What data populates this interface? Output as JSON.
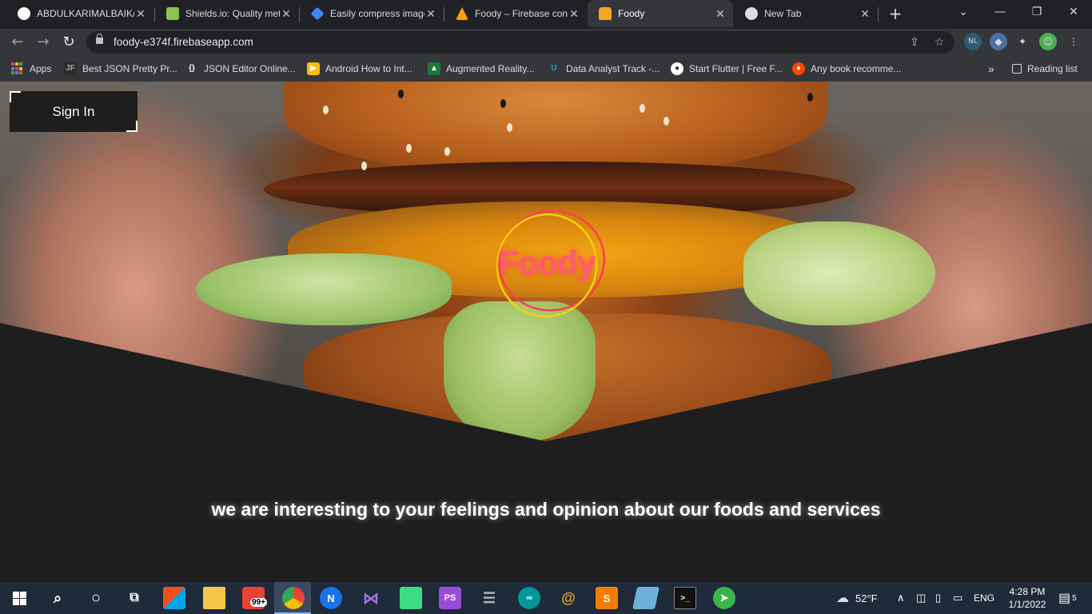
{
  "browser": {
    "tabs": [
      {
        "title": "ABDULKARIMALBAIK/",
        "favicon_color": "#ffffff",
        "active": false
      },
      {
        "title": "Shields.io: Quality met",
        "favicon_color": "#8bc34a",
        "active": false
      },
      {
        "title": "Easily compress image",
        "favicon_color": "#4285f4",
        "active": false
      },
      {
        "title": "Foody – Firebase cons",
        "favicon_color": "#ffa000",
        "active": false
      },
      {
        "title": "Foody",
        "favicon_color": "#f5a623",
        "active": true
      },
      {
        "title": "New Tab",
        "favicon_color": "#dadce0",
        "active": false
      }
    ],
    "url": "foody-e374f.firebaseapp.com",
    "bookmarks": [
      {
        "label": "Apps"
      },
      {
        "label": "Best JSON Pretty Pr...",
        "icon_text": "JF"
      },
      {
        "label": "JSON Editor Online...",
        "icon_text": "{}"
      },
      {
        "label": "Android How to Int...",
        "icon_text": "▶"
      },
      {
        "label": "Augmented Reality...",
        "icon_text": "▲"
      },
      {
        "label": "Data Analyst Track -...",
        "icon_text": "U"
      },
      {
        "label": "Start Flutter | Free F...",
        "icon_text": "●"
      },
      {
        "label": "Any book recomme...",
        "icon_text": "●"
      }
    ],
    "overflow_label": "»",
    "reading_list_label": "Reading list",
    "extension_badge": "NL"
  },
  "page": {
    "sign_in_label": "Sign In",
    "logo_text": "Foody",
    "tagline": "we are  interesting to your feelings and opinion about our foods and services"
  },
  "taskbar": {
    "weather_temp": "52°F",
    "language": "ENG",
    "time": "4:28 PM",
    "date": "1/1/2022",
    "gmail_badge": "99+",
    "notification_count": "5"
  },
  "colors": {
    "accent_logo": "#ff5c6c",
    "page_bg": "#1e1e1e",
    "taskbar_bg": "#1f2a3a"
  }
}
